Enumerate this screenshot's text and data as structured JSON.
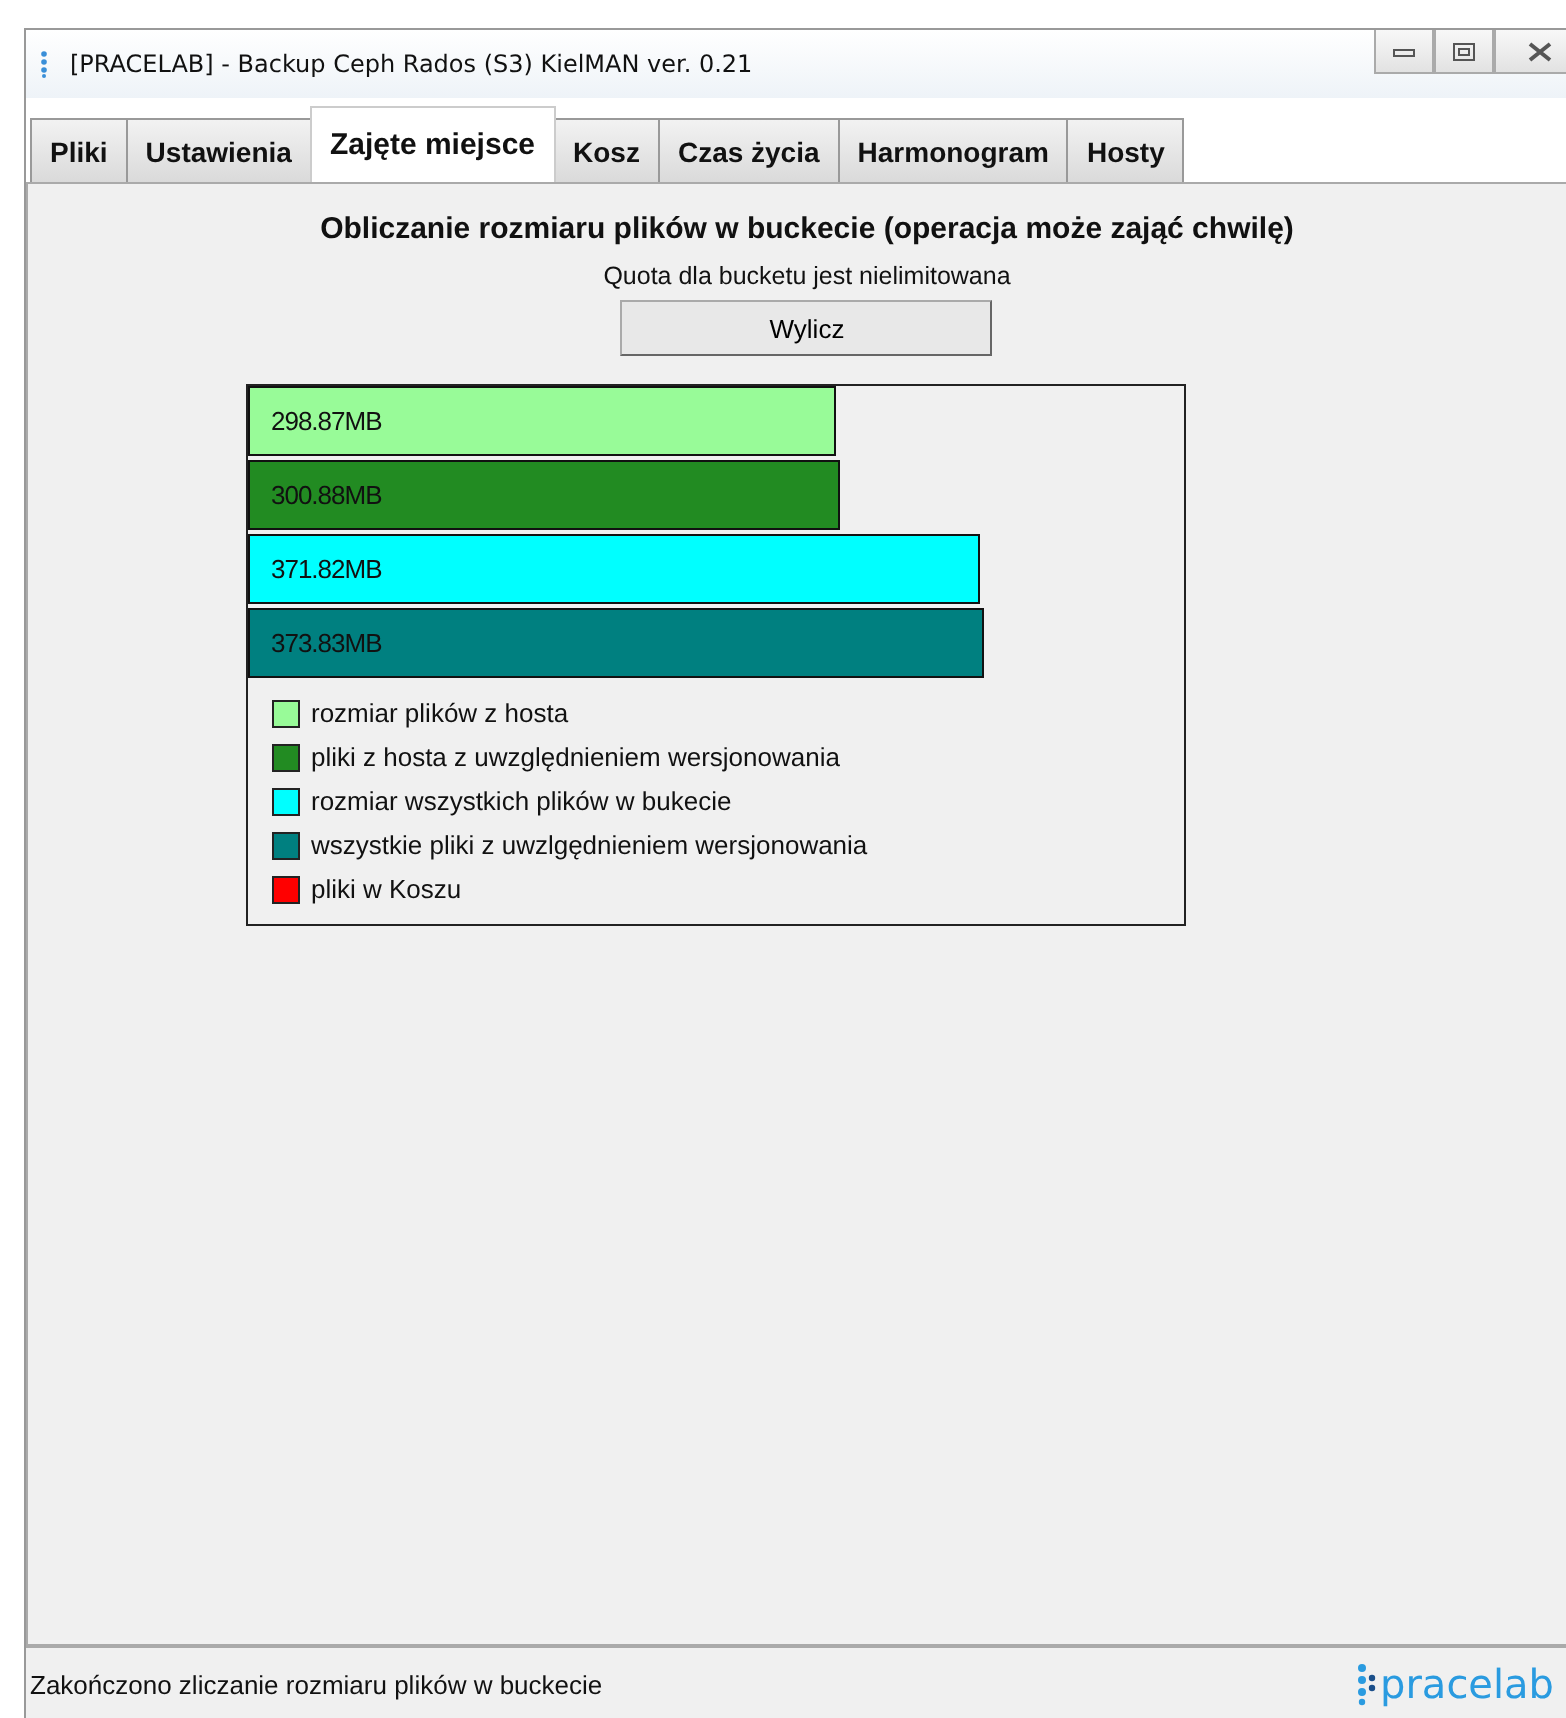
{
  "window": {
    "title": "[PRACELAB] - Backup Ceph Rados (S3) KielMAN ver. 0.21"
  },
  "tabs": [
    {
      "label": "Pliki",
      "selected": false
    },
    {
      "label": "Ustawienia",
      "selected": false
    },
    {
      "label": "Zajęte miejsce",
      "selected": true
    },
    {
      "label": "Kosz",
      "selected": false
    },
    {
      "label": "Czas życia",
      "selected": false
    },
    {
      "label": "Harmonogram",
      "selected": false
    },
    {
      "label": "Hosty",
      "selected": false
    }
  ],
  "heading": "Obliczanie rozmiaru plików w buckecie (operacja może zająć chwilę)",
  "quota_note": "Quota dla bucketu jest nielimitowana",
  "calculate_button": "Wylicz",
  "chart_data": {
    "type": "bar",
    "orientation": "horizontal",
    "xlim": [
      0,
      476
    ],
    "data_labels": true,
    "legend": true,
    "series": [
      {
        "name": "rozmiar plików z hosta",
        "color": "#98fb98",
        "values": [
          298.87
        ],
        "value_labels": [
          "298.87MB"
        ]
      },
      {
        "name": "pliki z hosta z uwzględnieniem wersjonowania",
        "color": "#228b22",
        "values": [
          300.88
        ],
        "value_labels": [
          "300.88MB"
        ]
      },
      {
        "name": "rozmiar wszystkich plików w bukecie",
        "color": "#00ffff",
        "values": [
          371.82
        ],
        "value_labels": [
          "371.82MB"
        ]
      },
      {
        "name": "wszystkie pliki z uwzlgędnieniem wersjonowania",
        "color": "#008080",
        "values": [
          373.83
        ],
        "value_labels": [
          "373.83MB"
        ]
      },
      {
        "name": "pliki w Koszu",
        "color": "#ff0000",
        "values": [
          null
        ]
      }
    ]
  },
  "status_bar": {
    "message": "Zakończono zliczanie rozmiaru plików w buckecie",
    "logo": "pracelab"
  }
}
